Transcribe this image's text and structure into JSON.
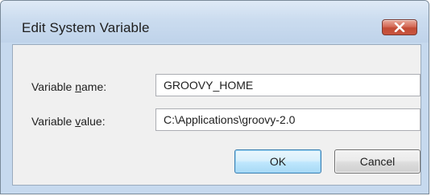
{
  "window": {
    "title": "Edit System Variable",
    "close_icon": "close-icon"
  },
  "form": {
    "name_label_prefix": "Variable ",
    "name_label_mnemonic": "n",
    "name_label_suffix": "ame:",
    "name_value": "GROOVY_HOME",
    "value_label_prefix": "Variable ",
    "value_label_mnemonic": "v",
    "value_label_suffix": "alue:",
    "value_value": "C:\\Applications\\groovy-2.0"
  },
  "buttons": {
    "ok_label": "OK",
    "cancel_label": "Cancel"
  },
  "colors": {
    "title_bar": "#cbdcef",
    "client_background": "#f0f0f0",
    "close_button": "#c8553f",
    "default_button_border": "#3c7fb1"
  }
}
